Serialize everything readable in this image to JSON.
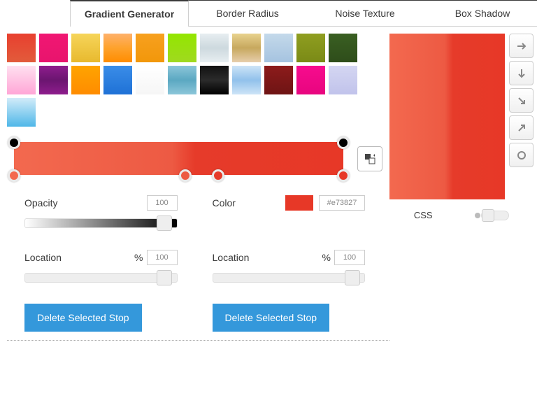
{
  "tabs": {
    "t0": "Gradient Generator",
    "t1": "Border Radius",
    "t2": "Noise Texture",
    "t3": "Box Shadow"
  },
  "swatches": [
    "linear-gradient(#e8402f,#e25b3b)",
    "linear-gradient(#f11773,#e8146d)",
    "linear-gradient(#f6d55a,#e8b92e)",
    "linear-gradient(#feb16b,#fea22c,#ff8c00)",
    "linear-gradient(#f7a01f,#f2970a)",
    "linear-gradient(#93e600,#a0d91f)",
    "linear-gradient(#e7eef1,#cdd9de,#e7eef1)",
    "linear-gradient(#e8d28e,#c7a85e,#e7ceac)",
    "linear-gradient(#c4d9ea,#a5c3e0)",
    "linear-gradient(#8f9e20,#7a8a16)",
    "linear-gradient(#3a5f22,#2e4d1a)",
    "linear-gradient(#ffe0f0,#ffa6d6)",
    "linear-gradient(#8e1d8d,#6b1570,#8e1d8d)",
    "linear-gradient(#ffa400,#ff8c00)",
    "linear-gradient(#3a8de8,#1f71d6)",
    "linear-gradient(#ffffff,#f6f6f6)",
    "linear-gradient(#8cc6d9,#5ba8c2,#8cc6d9)",
    "linear-gradient(#111,#2b2b2b,#000)",
    "linear-gradient(#cde4f7,#91c1eb,#cde4f7)",
    "linear-gradient(#8d1b1b,#6e1414)",
    "linear-gradient(#f70c8e,#e8057f)",
    "linear-gradient(#d4d6f2,#c1c3eb)",
    "linear-gradient(#d2ecf9,#4fb7e8)"
  ],
  "gradientBar": "linear-gradient(to right, #f3694f 0%, #ed5a43 48%, #e63b2a 55%, #e73827 100%)",
  "stops": {
    "opA": 0,
    "opB": 100,
    "c0": 0,
    "c1": 52,
    "c2": 62,
    "c3": 100
  },
  "opacity": {
    "label": "Opacity",
    "val": "100",
    "thumb": 92
  },
  "color": {
    "label": "Color",
    "hex": "#e73827",
    "sw": "#e73827"
  },
  "location": {
    "label": "Location",
    "pct": "%",
    "val": "100",
    "thumb": 92
  },
  "delLabel": "Delete Selected Stop",
  "preview": "linear-gradient(to right, #f3694f 0%, #ed5a43 48%, #e63b2a 55%, #e73827 100%)",
  "csslabel": "CSS"
}
